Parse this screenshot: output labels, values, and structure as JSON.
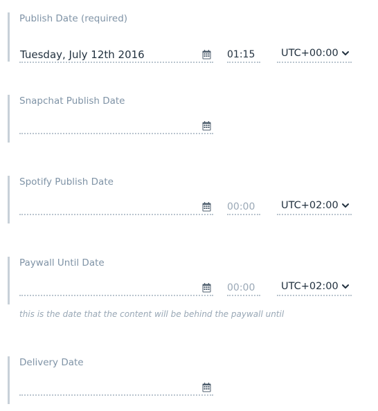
{
  "fields": [
    {
      "label": "Publish Date (required)",
      "date": "Tuesday, July 12th 2016",
      "time": "01:15",
      "timezone": "UTC+00:00"
    },
    {
      "label": "Snapchat Publish Date",
      "date": ""
    },
    {
      "label": "Spotify Publish Date",
      "date": "",
      "time_placeholder": "00:00",
      "timezone": "UTC+02:00"
    },
    {
      "label": "Paywall Until Date",
      "date": "",
      "time_placeholder": "00:00",
      "timezone": "UTC+02:00",
      "help": "this is the date that the content will be behind the paywall until"
    },
    {
      "label": "Delivery Date",
      "date": ""
    }
  ],
  "icons": {
    "calendar": "calendar-icon",
    "timezone_dropdown": "chevron-down-icon"
  },
  "colors": {
    "text": "#22313f",
    "label": "#7f93a6",
    "placeholder": "#9aa8b6",
    "border": "#c7d0d8"
  }
}
